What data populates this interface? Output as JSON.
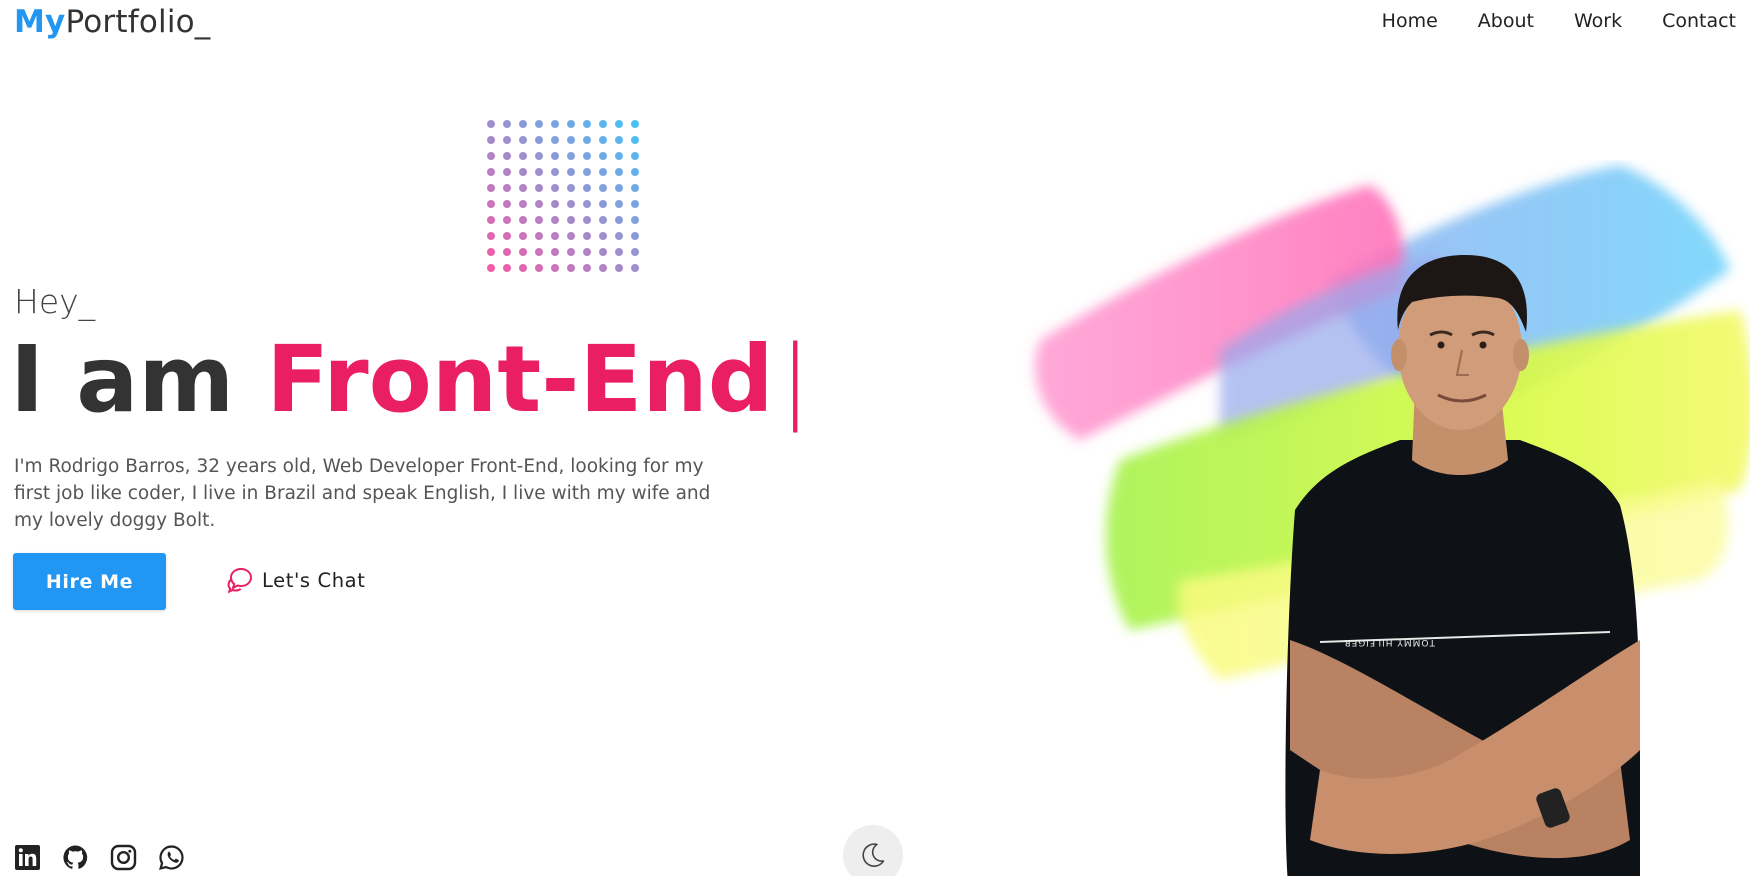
{
  "header": {
    "brand_prefix": "My",
    "brand_rest": "Portfolio_",
    "nav": [
      {
        "label": "Home"
      },
      {
        "label": "About"
      },
      {
        "label": "Work"
      },
      {
        "label": "Contact"
      }
    ]
  },
  "hero": {
    "greeting": "Hey_",
    "headline_prefix": "I am",
    "headline_role": "Front-End",
    "cursor": "|",
    "bio": "I'm Rodrigo Barros, 32 years old, Web Developer Front-End, looking for my first job like coder, I live in Brazil and speak English, I live with my wife and my lovely doggy Bolt.",
    "hire_label": "Hire Me",
    "chat_label": "Let's Chat"
  },
  "shirt_text": "TOMMY HILFIGER",
  "socials": [
    {
      "icon": "linkedin-icon"
    },
    {
      "icon": "github-icon"
    },
    {
      "icon": "instagram-icon"
    },
    {
      "icon": "whatsapp-icon"
    }
  ],
  "theme_toggle_icon": "moon-icon",
  "colors": {
    "accent_blue": "#2196f3",
    "accent_pink": "#e91e63",
    "text_dark": "#333333"
  }
}
